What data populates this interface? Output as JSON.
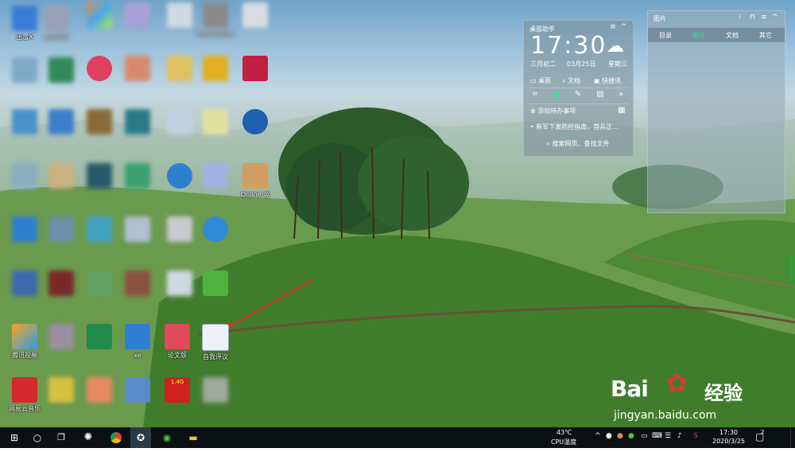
{
  "desktop": {
    "icons": [
      {
        "label": "迅雷X"
      },
      {
        "label": "酷狗音乐"
      },
      {
        "label": ""
      },
      {
        "label": ""
      },
      {
        "label": ""
      },
      {
        "label": "网易有道词典"
      },
      {
        "label": "腾讯视频"
      },
      {
        "label": "xe"
      },
      {
        "label": "论文版"
      },
      {
        "label": "自我评议"
      },
      {
        "label": "网易云音乐"
      },
      {
        "label": "1.4G"
      },
      {
        "label": "Online 英"
      }
    ]
  },
  "assistant": {
    "title": "桌面助手",
    "time": "17:30",
    "lunar_date": "三月初二",
    "date": "03月25日",
    "weekday": "星期三",
    "shortcuts": [
      "桌面",
      "文档",
      "快捷讯"
    ],
    "add_todo": "添加待办事项",
    "news": "• 新军下发防控指南，首兵正...",
    "search_placeholder": "搜索网页、查找文件"
  },
  "pictures_panel": {
    "title": "图片",
    "tabs": [
      {
        "label": "目录",
        "active": false
      },
      {
        "label": "图片",
        "active": true
      },
      {
        "label": "文档",
        "active": false
      },
      {
        "label": "其它",
        "active": false
      }
    ]
  },
  "watermark": {
    "logo": "Bai",
    "logo_cn": "经验",
    "url": "jingyan.baidu.com"
  },
  "taskbar": {
    "temperature": "43℃",
    "cpu_label": "CPU温度",
    "clock_time": "17:30",
    "clock_date": "2020/3/25",
    "notification_count": "2"
  },
  "colors": {
    "taskbar": "#0b1013",
    "accent_green": "#3ee08a",
    "arrow_red": "#e02b2b"
  }
}
